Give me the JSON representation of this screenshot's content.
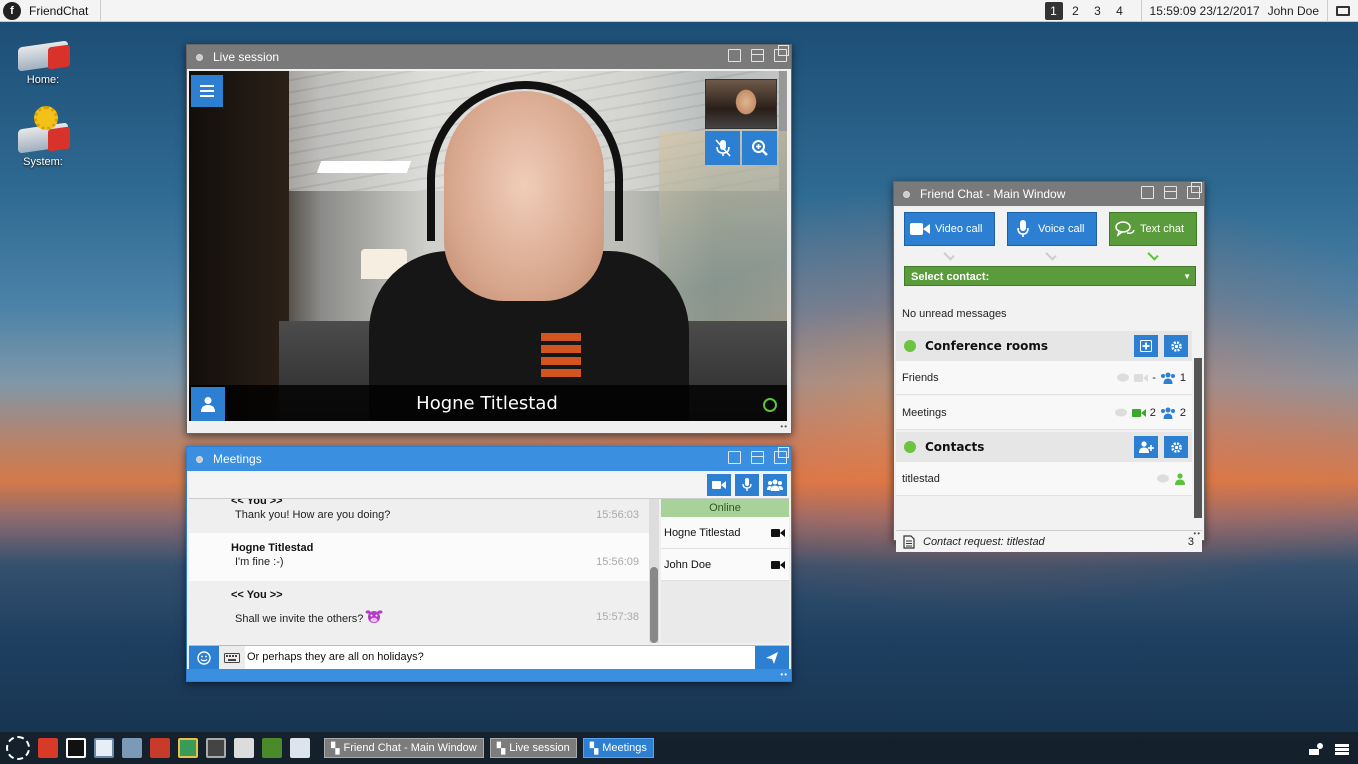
{
  "topbar": {
    "app_name": "FriendChat",
    "workspaces": [
      "1",
      "2",
      "3",
      "4"
    ],
    "active_workspace": "1",
    "clock": "15:59:09 23/12/2017",
    "user": "John Doe"
  },
  "desktop": {
    "icons": [
      {
        "label": "Home:",
        "icon": "drive-icon"
      },
      {
        "label": "System:",
        "icon": "system-drive-icon"
      }
    ]
  },
  "live_session": {
    "title": "Live session",
    "caller_name": "Hogne Titlestad"
  },
  "meetings": {
    "title": "Meetings",
    "messages": [
      {
        "from": "<< You >>",
        "text": "Thank you! How are you doing?",
        "time": "15:56:03"
      },
      {
        "from": "Hogne Titlestad",
        "text": "I'm fine :-)",
        "time": "15:56:09"
      },
      {
        "from": "<< You >>",
        "text": "Shall we invite the others?",
        "time": "15:57:38"
      }
    ],
    "online_header": "Online",
    "online_users": [
      "Hogne Titlestad",
      "John Doe"
    ],
    "input_value": "Or perhaps they are all on holidays?"
  },
  "main_window": {
    "title": "Friend Chat - Main Window",
    "buttons": {
      "video": "Video call",
      "voice": "Voice call",
      "text": "Text chat"
    },
    "select_contact": "Select contact:",
    "unread": "No unread messages",
    "conference_title": "Conference rooms",
    "rooms": [
      {
        "name": "Friends",
        "video_count": "-",
        "member_count": "1"
      },
      {
        "name": "Meetings",
        "video_count": "2",
        "member_count": "2"
      }
    ],
    "contacts_title": "Contacts",
    "contacts": [
      {
        "name": "titlestad"
      }
    ],
    "footer": {
      "text": "Contact request: titlestad",
      "count": "3"
    }
  },
  "taskbar": {
    "tasks": [
      {
        "label": "Friend Chat - Main Window",
        "active": false
      },
      {
        "label": "Live session",
        "active": false
      },
      {
        "label": "Meetings",
        "active": true
      }
    ]
  },
  "colors": {
    "accent": "#2d7fd1",
    "online_green": "#5bc23a",
    "select_green": "#5a9c3c"
  }
}
